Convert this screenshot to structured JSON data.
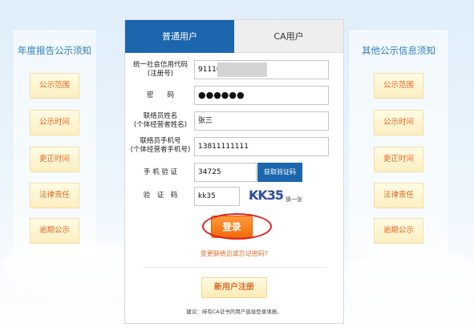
{
  "left_panel": {
    "title": "年度报告公示须知",
    "items": [
      "公示范围",
      "公示时间",
      "更正时间",
      "法律责任",
      "逾期公示"
    ]
  },
  "right_panel": {
    "title": "其他公示信息须知",
    "items": [
      "公示范围",
      "公示时间",
      "更正时间",
      "法律责任",
      "逾期公示"
    ]
  },
  "tabs": {
    "normal": "普通用户",
    "ca": "CA用户"
  },
  "form": {
    "credit_code": {
      "label_line1": "统一社会信用代码",
      "label_line2": "(注册号)",
      "value": "91110"
    },
    "password": {
      "label": "密　　码",
      "value": "●●●●●●"
    },
    "contact_name": {
      "label_line1": "联络员姓名",
      "label_line2": "(个体经营者姓名)",
      "value": "张三"
    },
    "contact_phone": {
      "label_line1": "联络员手机号",
      "label_line2": "(个体经营者手机号)",
      "value": "13811111111"
    },
    "sms_code": {
      "label": "手 机 验 证",
      "value": "34725",
      "button": "获取验证码"
    },
    "captcha": {
      "label": "验　证　码",
      "value": "kk35",
      "image_text": "KK35",
      "refresh": "换一张"
    }
  },
  "buttons": {
    "login": "登录",
    "forgot": "变更联络员或忘记密码?",
    "register": "新用户注册"
  },
  "note": "建议：持有CA证书的用户直接登录填报。",
  "colors": {
    "tab_active": "#1c66ad",
    "login_orange": "#f06a0d",
    "link_orange": "#e06a25",
    "side_title_blue": "#2e7fc4",
    "highlight_ring": "#e02020"
  }
}
